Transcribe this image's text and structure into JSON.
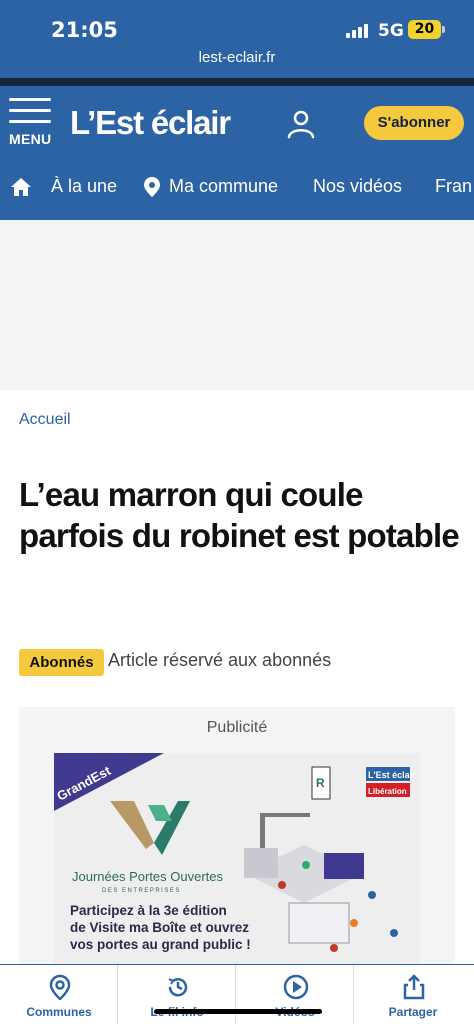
{
  "status_bar": {
    "time": "21:05",
    "network": "5G",
    "battery": "20",
    "url": "lest-eclair.fr"
  },
  "header": {
    "menu_label": "MENU",
    "logo": "L’Est éclair",
    "account_icon": "user-icon",
    "subscribe_label": "S'abonner",
    "nav": {
      "home_icon": "home-icon",
      "items": [
        "À la une",
        "Ma commune",
        "Nos vidéos",
        "Fran"
      ]
    }
  },
  "breadcrumb": "Accueil",
  "article": {
    "title": "L’eau marron qui coule parfois du robinet est potable",
    "badge": "Abonnés",
    "badge_note": "Article réservé aux abonnés"
  },
  "ad": {
    "label": "Publicité",
    "image_text": {
      "region": "GrandEst",
      "partners": [
        "L'Est éclair",
        "Libération"
      ],
      "event": "Journées Portes Ouvertes",
      "event_sub": "DES ENTREPRISES",
      "line1": "Participez à la 3e édition",
      "line2": "de Visite ma Boîte et ouvrez",
      "line3": "vos portes au grand public !"
    }
  },
  "tabbar": {
    "tabs": [
      {
        "label": "Communes",
        "icon": "location-pin-icon"
      },
      {
        "label": "Le fil info",
        "icon": "history-clock-icon"
      },
      {
        "label": "Vidéos",
        "icon": "play-circle-icon"
      },
      {
        "label": "Partager",
        "icon": "share-icon"
      }
    ]
  },
  "colors": {
    "brand_blue": "#2c63a4",
    "accent_yellow": "#f4c93d",
    "text_dark": "#111111"
  }
}
